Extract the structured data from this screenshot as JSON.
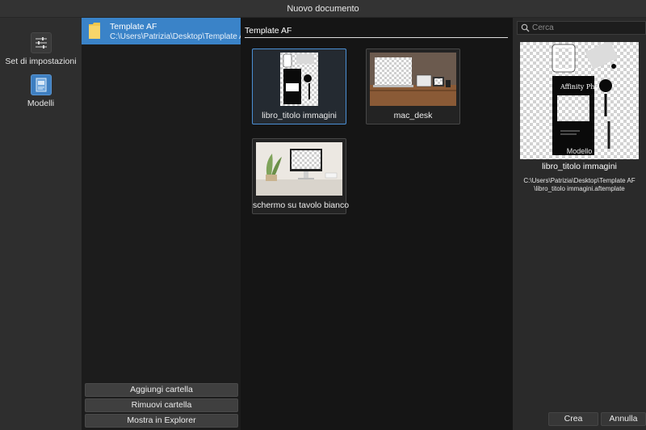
{
  "window": {
    "title": "Nuovo documento"
  },
  "sidebar": {
    "items": [
      {
        "label": "Set di impostazioni",
        "icon": "sliders-icon"
      },
      {
        "label": "Modelli",
        "icon": "templates-icon",
        "selected": true
      }
    ]
  },
  "folders": {
    "items": [
      {
        "name": "Template AF",
        "path": "C:\\Users\\Patrizia\\Desktop\\Template AF"
      }
    ],
    "buttons": {
      "add": "Aggiungi cartella",
      "remove": "Rimuovi cartella",
      "explorer": "Mostra in Explorer"
    }
  },
  "gallery": {
    "heading": "Template AF",
    "templates": [
      {
        "name": "libro_titolo immagini",
        "selected": true
      },
      {
        "name": "mac_desk"
      },
      {
        "name": "schermo su tavolo bianco"
      }
    ]
  },
  "details": {
    "search_placeholder": "Cerca",
    "type_label": "Modello",
    "name": "libro_titolo immagini",
    "path_line1": "C:\\Users\\Patrizia\\Desktop\\Template AF",
    "path_line2": "\\libro_titolo immagini.aftemplate",
    "book_title": "Affinity Photo"
  },
  "actions": {
    "create": "Crea",
    "cancel": "Annulla"
  },
  "colors": {
    "accent": "#3a83c8",
    "selection_border": "#4b8fd4",
    "background": "#2b2b2b"
  }
}
